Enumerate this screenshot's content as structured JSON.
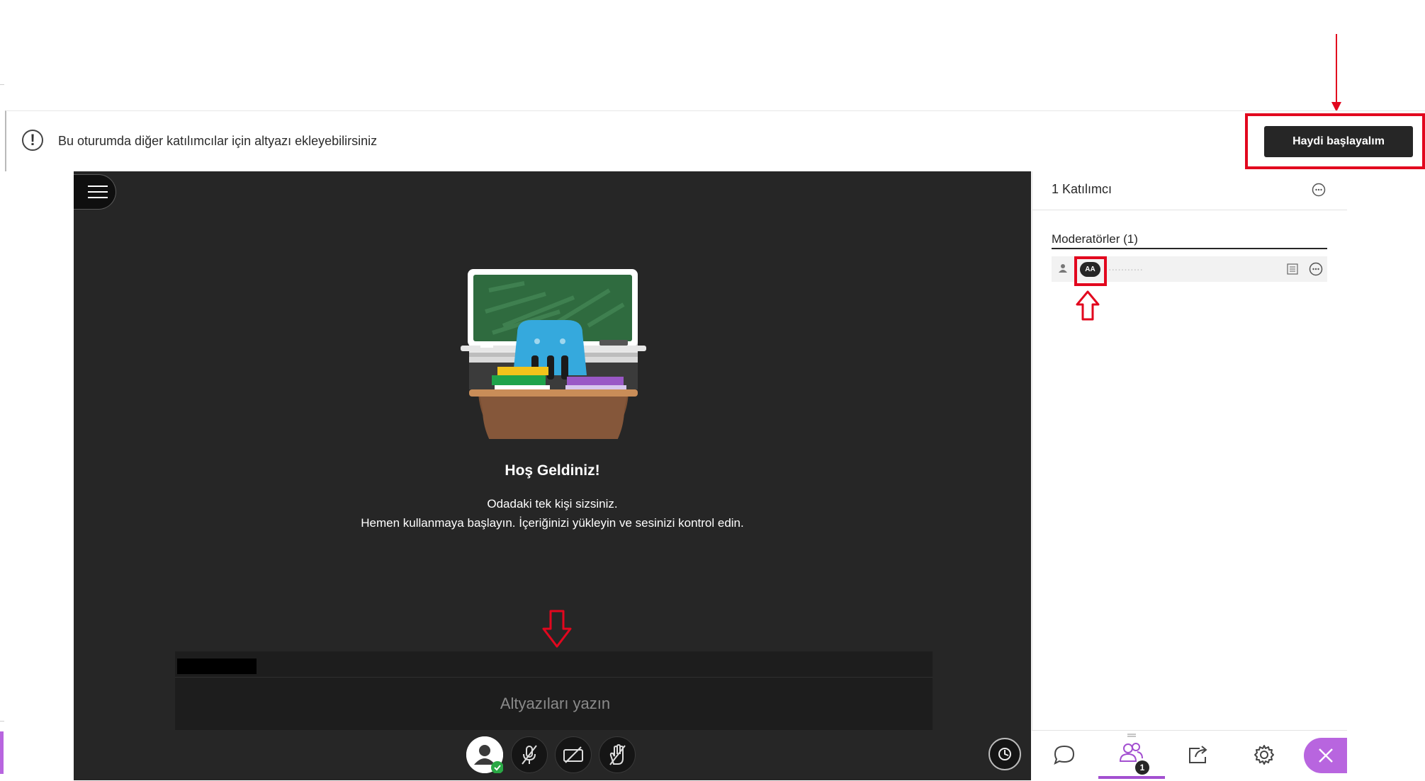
{
  "banner": {
    "message": "Bu oturumda diğer katılımcılar için altyazı ekleyebilirsiniz",
    "info_icon": "exclamation-circle-icon",
    "start_button": "Haydi başlayalım"
  },
  "stage": {
    "welcome_title": "Hoş Geldiniz!",
    "welcome_line1": "Odadaki tek kişi sizsiniz.",
    "welcome_line2": "Hemen kullanmaya başlayın. İçeriğinizi yükleyin ve sesinizi kontrol edin.",
    "caption_placeholder": "Altyazıları yazın"
  },
  "controls": {
    "avatar_icon": "avatar-icon",
    "mic_icon": "mic-off-icon",
    "camera_icon": "camera-off-icon",
    "hand_icon": "raise-hand-icon",
    "clock_icon": "clock-icon"
  },
  "panel": {
    "participants_title": "1 Katılımcı",
    "moderators_title": "Moderatörler (1)",
    "moderator": {
      "badge": "AA",
      "name": "..........."
    }
  },
  "tabs": {
    "participants_count": "1",
    "items": [
      "chat-icon",
      "participants-icon",
      "share-icon",
      "settings-icon",
      "close-icon"
    ]
  },
  "colors": {
    "stage_bg": "#262626",
    "accent_red": "#e2071e",
    "purple": "#a34fd0",
    "close_tab_bg": "#b865df"
  }
}
